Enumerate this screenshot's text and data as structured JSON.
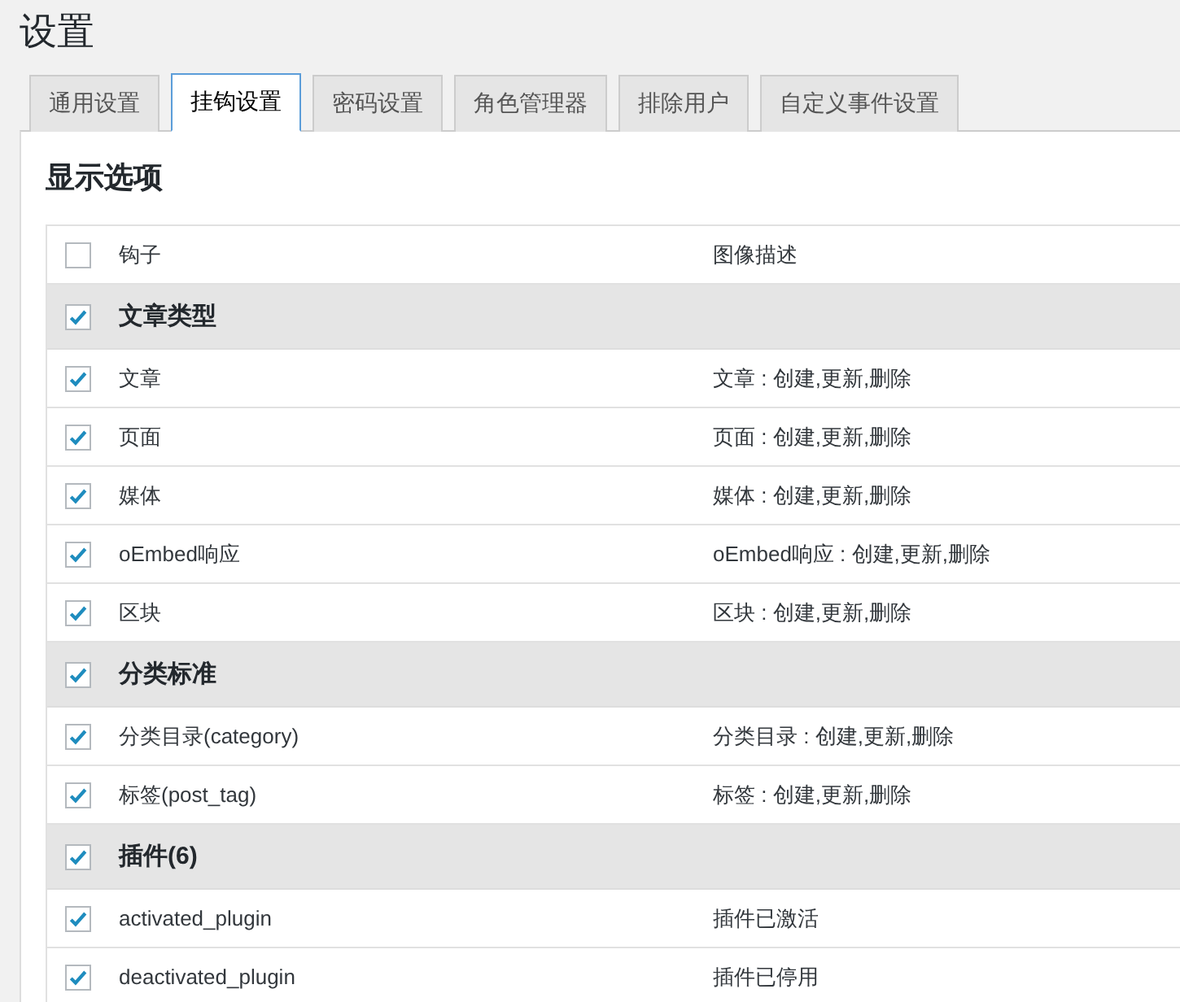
{
  "page_title": "设置",
  "tabs": [
    {
      "label": "通用设置",
      "selected": false
    },
    {
      "label": "挂钩设置",
      "selected": true
    },
    {
      "label": "密码设置",
      "selected": false
    },
    {
      "label": "角色管理器",
      "selected": false
    },
    {
      "label": "排除用户",
      "selected": false
    },
    {
      "label": "自定义事件设置",
      "selected": false
    }
  ],
  "section_title": "显示选项",
  "table": {
    "header": {
      "checked": false,
      "columns": [
        "钩子",
        "图像描述"
      ]
    },
    "groups": [
      {
        "title": "文章类型",
        "checked": true,
        "rows": [
          {
            "hook": "文章",
            "description": "文章 : 创建,更新,删除",
            "checked": true
          },
          {
            "hook": "页面",
            "description": "页面 : 创建,更新,删除",
            "checked": true
          },
          {
            "hook": "媒体",
            "description": "媒体 : 创建,更新,删除",
            "checked": true
          },
          {
            "hook": "oEmbed响应",
            "description": "oEmbed响应 : 创建,更新,删除",
            "checked": true
          },
          {
            "hook": "区块",
            "description": "区块 : 创建,更新,删除",
            "checked": true
          }
        ]
      },
      {
        "title": "分类标准",
        "checked": true,
        "rows": [
          {
            "hook": "分类目录(category)",
            "description": "分类目录 : 创建,更新,删除",
            "checked": true
          },
          {
            "hook": "标签(post_tag)",
            "description": "标签 : 创建,更新,删除",
            "checked": true
          }
        ]
      },
      {
        "title": "插件(6)",
        "checked": true,
        "rows": [
          {
            "hook": "activated_plugin",
            "description": "插件已激活",
            "checked": true
          },
          {
            "hook": "deactivated_plugin",
            "description": "插件已停用",
            "checked": true
          }
        ]
      }
    ]
  }
}
